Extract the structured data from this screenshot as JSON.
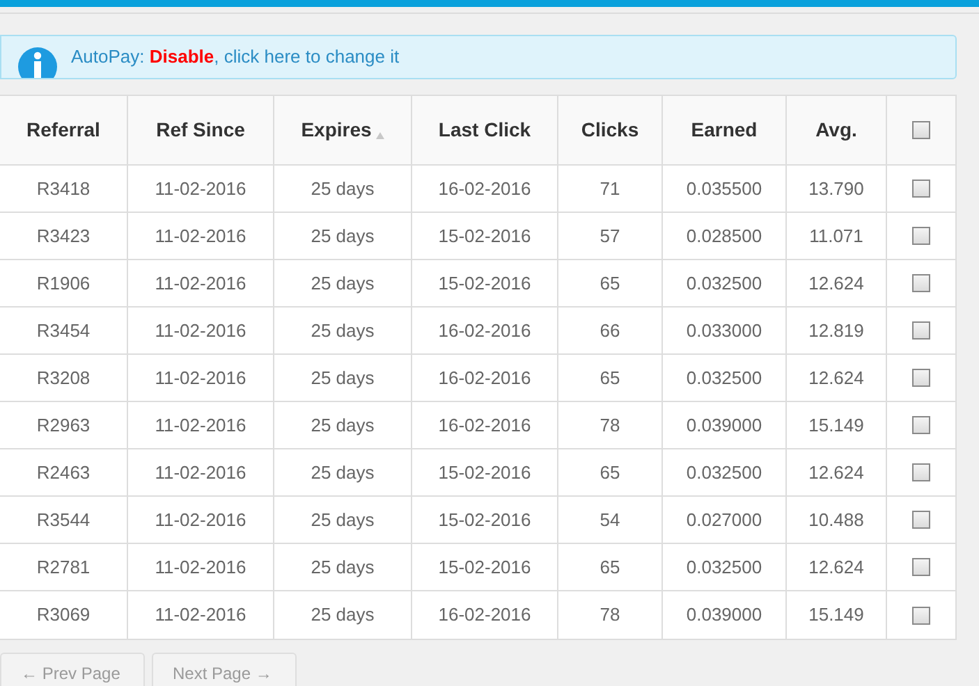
{
  "alert": {
    "label": "AutoPay:",
    "status": "Disable",
    "message": ", click here to change it"
  },
  "table": {
    "columns": [
      {
        "label": "Referral",
        "sorted": false
      },
      {
        "label": "Ref Since",
        "sorted": false
      },
      {
        "label": "Expires",
        "sorted": true
      },
      {
        "label": "Last Click",
        "sorted": false
      },
      {
        "label": "Clicks",
        "sorted": false
      },
      {
        "label": "Earned",
        "sorted": false
      },
      {
        "label": "Avg.",
        "sorted": false
      }
    ],
    "select_all": {
      "checked": false
    },
    "rows": [
      {
        "cells": [
          "R3418",
          "11-02-2016",
          "25 days",
          "16-02-2016",
          "71",
          "0.035500",
          "13.790"
        ],
        "checked": false
      },
      {
        "cells": [
          "R3423",
          "11-02-2016",
          "25 days",
          "15-02-2016",
          "57",
          "0.028500",
          "11.071"
        ],
        "checked": false
      },
      {
        "cells": [
          "R1906",
          "11-02-2016",
          "25 days",
          "15-02-2016",
          "65",
          "0.032500",
          "12.624"
        ],
        "checked": false
      },
      {
        "cells": [
          "R3454",
          "11-02-2016",
          "25 days",
          "16-02-2016",
          "66",
          "0.033000",
          "12.819"
        ],
        "checked": false
      },
      {
        "cells": [
          "R3208",
          "11-02-2016",
          "25 days",
          "16-02-2016",
          "65",
          "0.032500",
          "12.624"
        ],
        "checked": false
      },
      {
        "cells": [
          "R2963",
          "11-02-2016",
          "25 days",
          "16-02-2016",
          "78",
          "0.039000",
          "15.149"
        ],
        "checked": false
      },
      {
        "cells": [
          "R2463",
          "11-02-2016",
          "25 days",
          "15-02-2016",
          "65",
          "0.032500",
          "12.624"
        ],
        "checked": false
      },
      {
        "cells": [
          "R3544",
          "11-02-2016",
          "25 days",
          "15-02-2016",
          "54",
          "0.027000",
          "10.488"
        ],
        "checked": false
      },
      {
        "cells": [
          "R2781",
          "11-02-2016",
          "25 days",
          "15-02-2016",
          "65",
          "0.032500",
          "12.624"
        ],
        "checked": false
      },
      {
        "cells": [
          "R3069",
          "11-02-2016",
          "25 days",
          "16-02-2016",
          "78",
          "0.039000",
          "15.149"
        ],
        "checked": false
      }
    ]
  },
  "pager": [
    {
      "label": "← Prev Page",
      "disabled": true
    },
    {
      "label": "Next Page →",
      "disabled": true
    }
  ]
}
